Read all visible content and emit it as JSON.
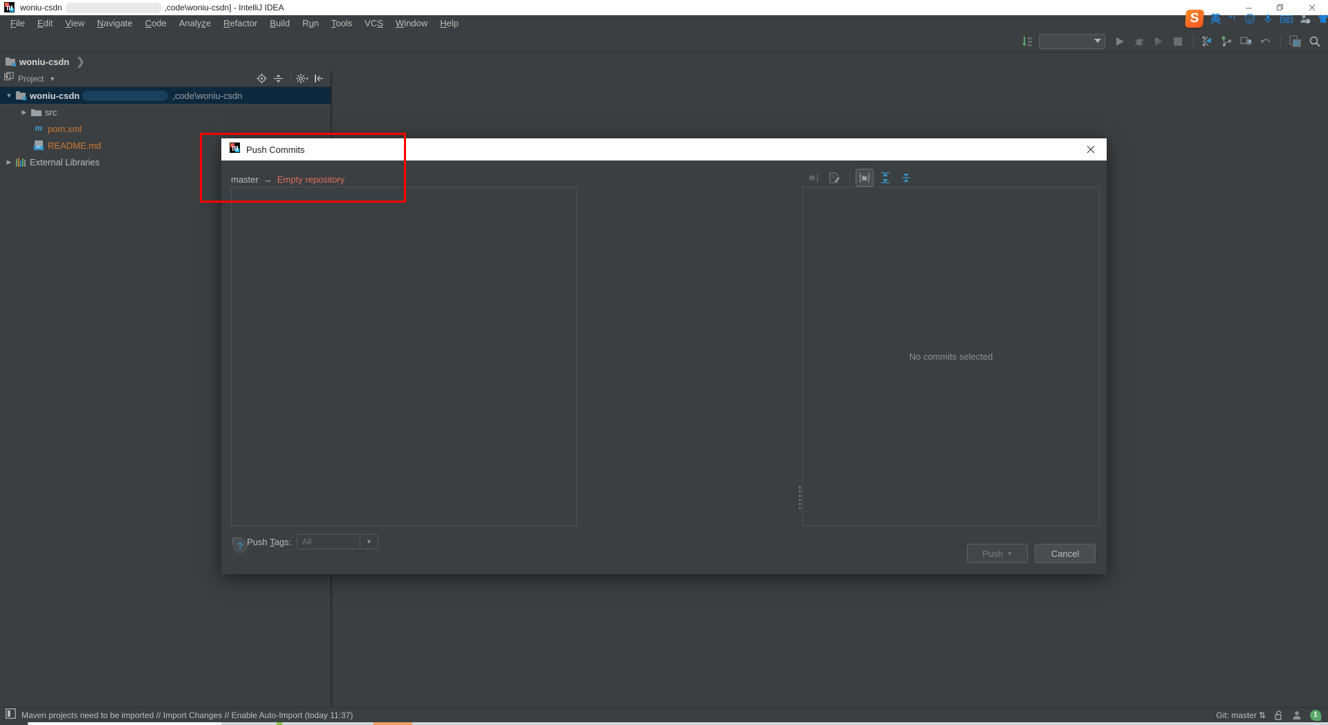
{
  "window": {
    "title_prefix": "woniu-csdn",
    "title_suffix": ",code\\woniu-csdn] - IntelliJ IDEA",
    "app_icon": "intellij-idea-logo",
    "controls": {
      "minimize": "minimize-icon",
      "restore": "restore-icon",
      "close": "close-icon"
    }
  },
  "menubar": {
    "items": [
      {
        "label": "File",
        "mnemonic": "F"
      },
      {
        "label": "Edit",
        "mnemonic": "E"
      },
      {
        "label": "View",
        "mnemonic": "V"
      },
      {
        "label": "Navigate",
        "mnemonic": "N"
      },
      {
        "label": "Code",
        "mnemonic": "C"
      },
      {
        "label": "Analyze",
        "mnemonic": "z"
      },
      {
        "label": "Refactor",
        "mnemonic": "R"
      },
      {
        "label": "Build",
        "mnemonic": "B"
      },
      {
        "label": "Run",
        "mnemonic": "u"
      },
      {
        "label": "Tools",
        "mnemonic": "T"
      },
      {
        "label": "VCS",
        "mnemonic": "S"
      },
      {
        "label": "Window",
        "mnemonic": "W"
      },
      {
        "label": "Help",
        "mnemonic": "H"
      }
    ]
  },
  "ime_bar": {
    "logo": "sogou-logo",
    "items": [
      "chinese-mode-icon",
      "punctuation-icon",
      "emoji-icon",
      "voice-input-icon",
      "soft-keyboard-icon",
      "toolbox-icon",
      "skin-icon",
      "apps-icon"
    ],
    "chinese_label": "英"
  },
  "toolbar": {
    "right_items": [
      "update-project-icon",
      "run-configurations-combo",
      "run-icon",
      "debug-icon",
      "coverage-icon",
      "stop-icon",
      "update-project-vcs-icon",
      "commit-icon",
      "diff-icon",
      "rollback-icon",
      "database-icon",
      "search-everywhere-icon"
    ],
    "run_config_value": ""
  },
  "navbar": {
    "breadcrumb": "woniu-csdn"
  },
  "project_pane": {
    "title": "Project",
    "tools": [
      "locate-icon",
      "collapse-all-icon",
      "settings-gear-icon",
      "hide-icon"
    ],
    "tree": [
      {
        "name": "woniu-csdn",
        "path_hint": ",code\\woniu-csdn",
        "icon": "module-folder-icon",
        "selected": true,
        "expanded": true,
        "depth": 0
      },
      {
        "name": "src",
        "icon": "folder-icon",
        "expanded": false,
        "depth": 1
      },
      {
        "name": "pom.xml",
        "icon": "maven-file-icon",
        "depth": 2,
        "color": "orange"
      },
      {
        "name": "README.md",
        "icon": "markdown-file-icon",
        "depth": 2,
        "color": "orange"
      },
      {
        "name": "External Libraries",
        "icon": "libraries-icon",
        "expanded": false,
        "depth": 0
      }
    ]
  },
  "dialog": {
    "title": "Push Commits",
    "icon": "intellij-idea-logo",
    "close_label": "✕",
    "branch": {
      "source": "master",
      "arrow": "→",
      "target": "Empty repository"
    },
    "detail_toolbar": [
      {
        "name": "collapse-changes-icon",
        "active": false
      },
      {
        "name": "show-diff-icon",
        "active": false
      },
      {
        "name": "group-by-directory-icon",
        "active": true
      },
      {
        "name": "expand-all-icon",
        "active": false
      },
      {
        "name": "collapse-all-icon",
        "active": false
      }
    ],
    "detail_empty_message": "No commits selected",
    "push_tags": {
      "label": "Push Tags:",
      "mnemonic": "T",
      "checked": false,
      "combo_value": "All",
      "combo_enabled": false
    },
    "help_label": "?",
    "buttons": [
      {
        "label": "Push",
        "has_dropdown": true,
        "enabled": false,
        "name": "push-button"
      },
      {
        "label": "Cancel",
        "has_dropdown": false,
        "enabled": true,
        "name": "cancel-button"
      }
    ]
  },
  "statusbar": {
    "message": "Maven projects need to be imported // Import Changes // Enable Auto-Import (today 11:37)",
    "icon": "maven-notification-icon",
    "vcs_label": "Git: master",
    "vcs_arrows": "⇅",
    "right_icons": [
      "lock-icon",
      "person-icon"
    ],
    "notification_count": "1"
  },
  "annotation": {
    "color": "#ff0000",
    "shape": "rectangle"
  },
  "colors": {
    "app_bg": "#3c3f41",
    "panel_bg": "#3c3f41",
    "titlebar_bg": "#ffffff",
    "selection_bg": "#0d293e",
    "accent_blue": "#3592c4",
    "error_red": "#e06c5f",
    "file_orange": "#cc7832",
    "annot_red": "#ff0000"
  }
}
